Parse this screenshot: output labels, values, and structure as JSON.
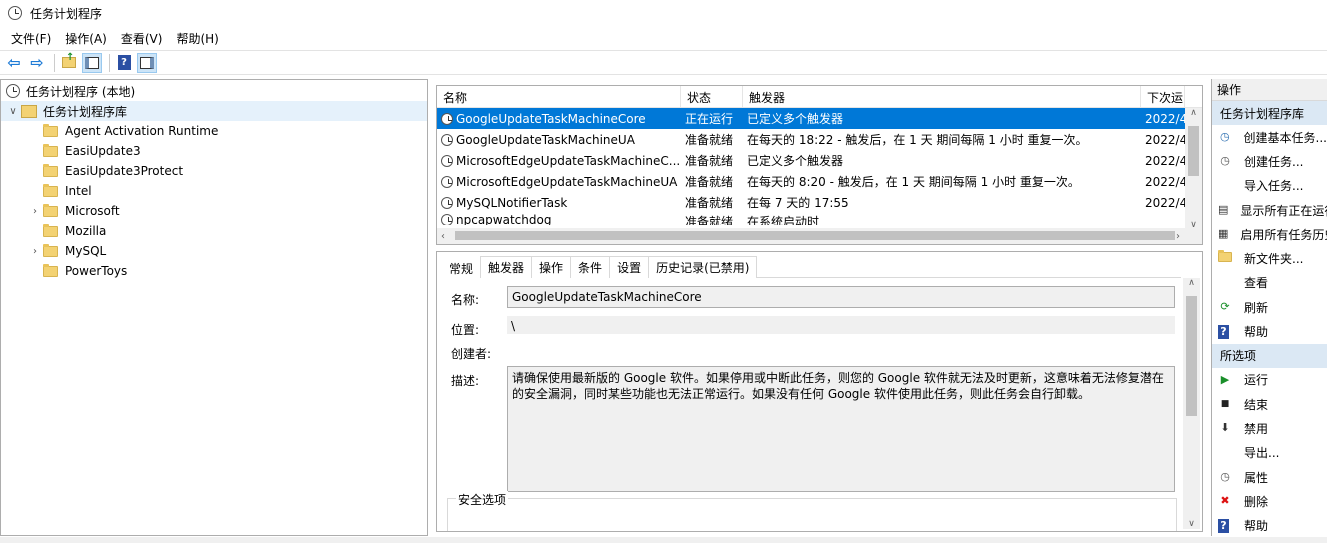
{
  "window": {
    "title": "任务计划程序"
  },
  "menu": [
    "文件(F)",
    "操作(A)",
    "查看(V)",
    "帮助(H)"
  ],
  "tree": {
    "root": "任务计划程序 (本地)",
    "library": "任务计划程序库",
    "folders": [
      {
        "name": "Agent Activation Runtime",
        "expandable": false
      },
      {
        "name": "EasiUpdate3",
        "expandable": false
      },
      {
        "name": "EasiUpdate3Protect",
        "expandable": false
      },
      {
        "name": "Intel",
        "expandable": false
      },
      {
        "name": "Microsoft",
        "expandable": true
      },
      {
        "name": "Mozilla",
        "expandable": false
      },
      {
        "name": "MySQL",
        "expandable": true
      },
      {
        "name": "PowerToys",
        "expandable": false
      }
    ]
  },
  "tasks": {
    "columns": [
      "名称",
      "状态",
      "触发器",
      "下次运"
    ],
    "rows": [
      {
        "name": "GoogleUpdateTaskMachineCore",
        "status": "正在运行",
        "trigger": "已定义多个触发器",
        "next": "2022/4"
      },
      {
        "name": "GoogleUpdateTaskMachineUA",
        "status": "准备就绪",
        "trigger": "在每天的 18:22 - 触发后，在 1 天 期间每隔 1 小时 重复一次。",
        "next": "2022/4"
      },
      {
        "name": "MicrosoftEdgeUpdateTaskMachineC...",
        "status": "准备就绪",
        "trigger": "已定义多个触发器",
        "next": "2022/4"
      },
      {
        "name": "MicrosoftEdgeUpdateTaskMachineUA",
        "status": "准备就绪",
        "trigger": "在每天的 8:20 - 触发后，在 1 天 期间每隔 1 小时 重复一次。",
        "next": "2022/4"
      },
      {
        "name": "MySQLNotifierTask",
        "status": "准备就绪",
        "trigger": "在每 7 天的 17:55",
        "next": "2022/4"
      },
      {
        "name": "npcapwatchdog",
        "status": "准备就绪",
        "trigger": "在系统启动时",
        "next": ""
      }
    ]
  },
  "detail": {
    "tabs": [
      "常规",
      "触发器",
      "操作",
      "条件",
      "设置",
      "历史记录(已禁用)"
    ],
    "name_label": "名称:",
    "name_value": "GoogleUpdateTaskMachineCore",
    "location_label": "位置:",
    "location_value": "\\",
    "author_label": "创建者:",
    "desc_label": "描述:",
    "desc_value": "请确保使用最新版的 Google 软件。如果停用或中断此任务，则您的 Google 软件就无法及时更新，这意味着无法修复潜在的安全漏洞，同时某些功能也无法正常运行。如果没有任何 Google 软件使用此任务，则此任务会自行卸载。",
    "security_label": "安全选项"
  },
  "actions": {
    "header": "操作",
    "section1": "任务计划程序库",
    "items1": [
      {
        "label": "创建基本任务...",
        "icon": "wizard-icon"
      },
      {
        "label": "创建任务...",
        "icon": "task-icon"
      },
      {
        "label": "导入任务...",
        "icon": ""
      },
      {
        "label": "显示所有正在运行",
        "icon": "list-icon"
      },
      {
        "label": "启用所有任务历史",
        "icon": "history-icon"
      },
      {
        "label": "新文件夹...",
        "icon": "folder-icon"
      },
      {
        "label": "查看",
        "icon": ""
      },
      {
        "label": "刷新",
        "icon": "refresh-icon"
      },
      {
        "label": "帮助",
        "icon": "help-icon"
      }
    ],
    "section2": "所选项",
    "items2": [
      {
        "label": "运行",
        "icon": "run-icon"
      },
      {
        "label": "结束",
        "icon": "stop-icon"
      },
      {
        "label": "禁用",
        "icon": "disable-icon"
      },
      {
        "label": "导出...",
        "icon": ""
      },
      {
        "label": "属性",
        "icon": "properties-icon"
      },
      {
        "label": "删除",
        "icon": "delete-icon"
      },
      {
        "label": "帮助",
        "icon": "help-icon"
      }
    ]
  }
}
